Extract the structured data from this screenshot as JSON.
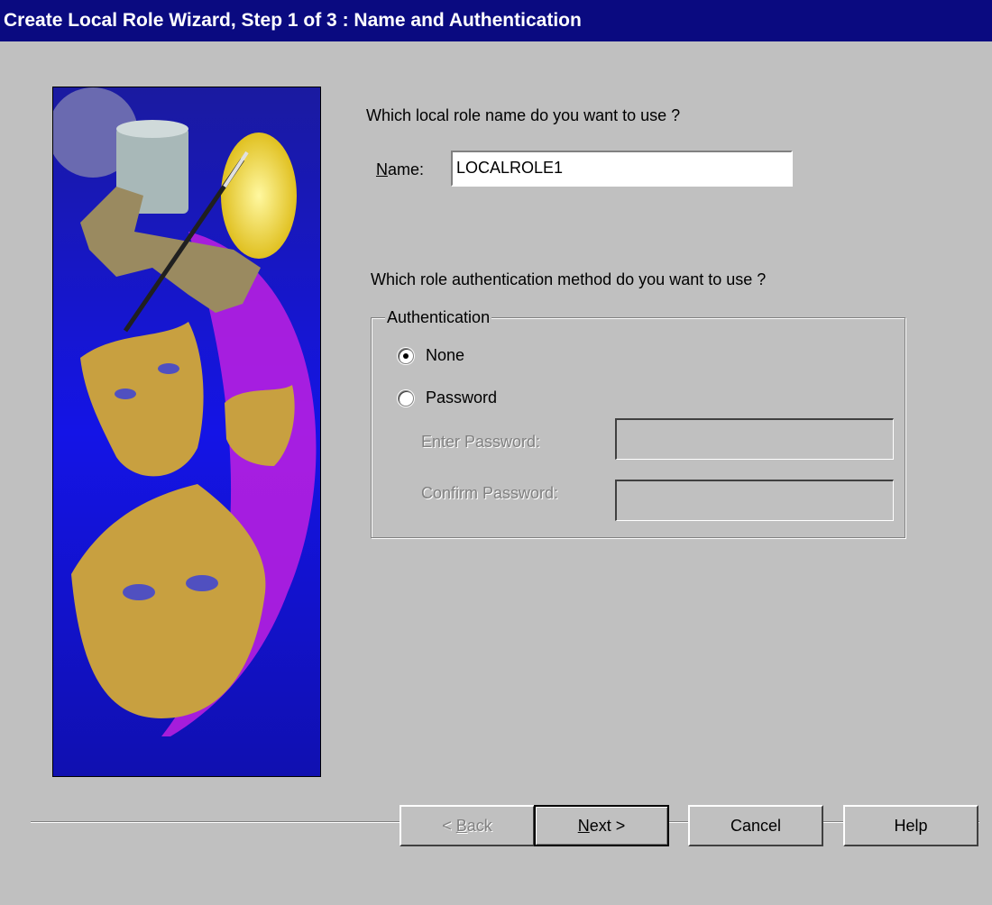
{
  "window": {
    "title": "Create Local Role Wizard, Step 1 of 3 : Name and Authentication"
  },
  "name_section": {
    "question": "Which local role name do you want to use ?",
    "name_label_mnemonic": "N",
    "name_label_rest": "ame:",
    "name_value": "LOCALROLE1"
  },
  "auth_section": {
    "question": "Which role authentication method do you want to use ?",
    "group_label": "Authentication",
    "options": [
      {
        "label": "None",
        "selected": true
      },
      {
        "label": "Password",
        "selected": false
      }
    ],
    "enter_password_label": "Enter Password:",
    "confirm_password_label": "Confirm Password:"
  },
  "buttons": {
    "back_prefix": "< ",
    "back_mnemonic": "B",
    "back_rest": "ack",
    "next_mnemonic": "N",
    "next_rest": "ext >",
    "cancel": "Cancel",
    "help": "Help"
  },
  "colors": {
    "titlebar": "#0a0a80",
    "dialog": "#c0c0c0",
    "art_blue": "#1414e6",
    "art_purple": "#c020e0",
    "art_gold": "#c8a040"
  }
}
